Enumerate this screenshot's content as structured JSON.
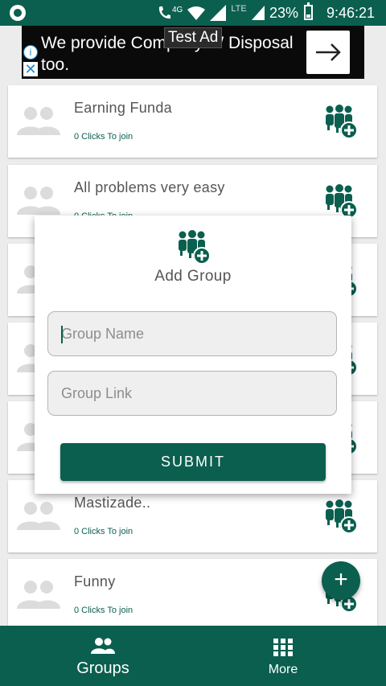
{
  "status_bar": {
    "network_label": "4G",
    "lte_label": "LTE",
    "battery": "23%",
    "time": "9:46:21"
  },
  "ad": {
    "text": "We provide Company W Disposal too.",
    "badge": "Test Ad",
    "info_icon": "info-icon",
    "close_icon": "close-icon",
    "arrow_icon": "arrow-right-icon"
  },
  "groups": [
    {
      "name": "Earning Funda",
      "clicks": "0 Clicks To join"
    },
    {
      "name": "All problems very easy",
      "clicks": "0 Clicks To join"
    },
    {
      "name": "",
      "clicks": ""
    },
    {
      "name": "",
      "clicks": ""
    },
    {
      "name": "",
      "clicks": ""
    },
    {
      "name": "Mastizade..",
      "clicks": "0 Clicks To join"
    },
    {
      "name": "Funny",
      "clicks": "0 Clicks To join"
    }
  ],
  "dialog": {
    "title": "Add Group",
    "group_name_placeholder": "Group Name",
    "group_name_value": "",
    "group_link_placeholder": "Group Link",
    "group_link_value": "",
    "submit_label": "SUBMIT"
  },
  "fab": {
    "label": "+"
  },
  "bottom_nav": {
    "items": [
      {
        "label": "Groups",
        "icon": "people-icon",
        "active": true
      },
      {
        "label": "More",
        "icon": "grid-icon",
        "active": false
      }
    ]
  },
  "colors": {
    "primary": "#0b5f4f",
    "background": "#ececec",
    "card": "#ffffff"
  }
}
